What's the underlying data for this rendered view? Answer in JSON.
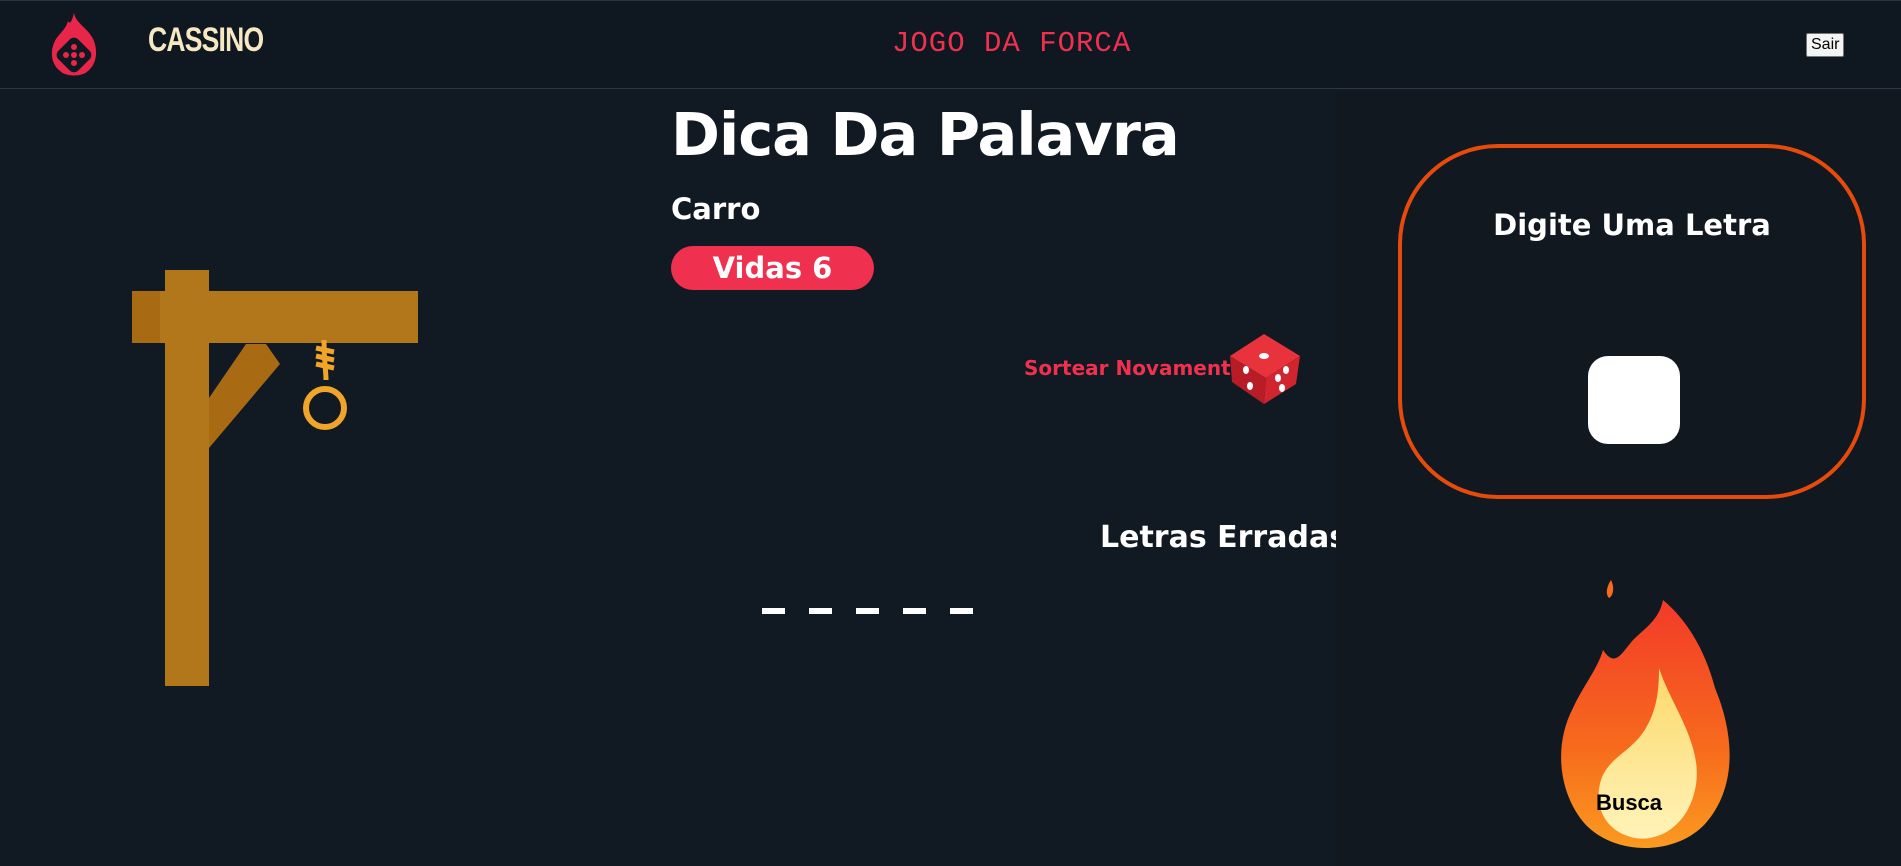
{
  "header": {
    "brand": "CASSINO",
    "game_title": "JOGO DA FORCA",
    "logout_label": "Sair"
  },
  "hint": {
    "title": "Dica Da Palavra",
    "word_hint": "Carro"
  },
  "lives": {
    "label": "Vidas 6",
    "count": 6
  },
  "redraw_label": "Sortear Novamente",
  "wrong_letters": {
    "title": "Letras Erradas",
    "letters": []
  },
  "word": {
    "length": 5,
    "revealed": [
      "",
      "",
      "",
      "",
      ""
    ]
  },
  "input_panel": {
    "label": "Digite Uma Letra",
    "value": ""
  },
  "search_label": "Busca",
  "colors": {
    "background": "#111922",
    "accent": "#f0304f",
    "panel_border": "#e64a0c",
    "brand": "#f7e8c4",
    "gallows_wood": "#b3771b"
  },
  "icons": [
    "dice-logo-icon",
    "gallows-icon",
    "dice-icon",
    "fire-icon"
  ]
}
